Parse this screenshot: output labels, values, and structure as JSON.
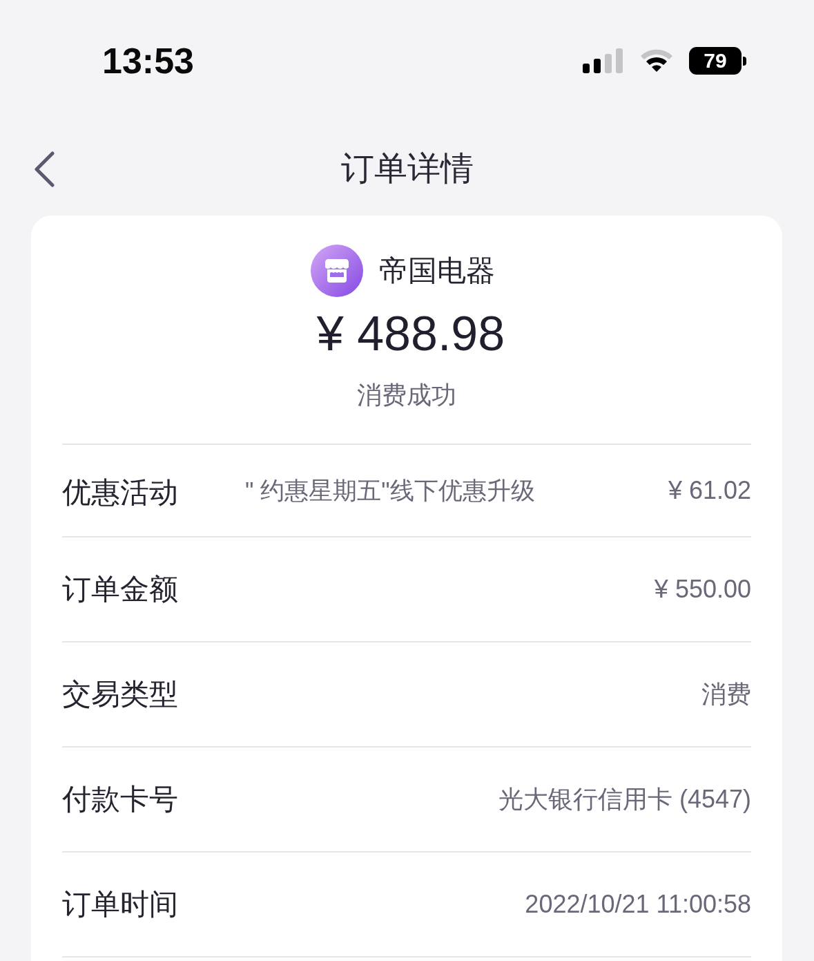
{
  "status_bar": {
    "time": "13:53",
    "battery": "79"
  },
  "nav": {
    "title": "订单详情"
  },
  "merchant": {
    "name": "帝国电器"
  },
  "summary": {
    "amount": "¥ 488.98",
    "status": "消费成功"
  },
  "rows": [
    {
      "kind": "promo",
      "label": "优惠活动",
      "detail": "\" 约惠星期五\"线下优惠升级",
      "value": "¥ 61.02"
    },
    {
      "kind": "plain",
      "label": "订单金额",
      "value": "¥ 550.00"
    },
    {
      "kind": "plain",
      "label": "交易类型",
      "value": "消费"
    },
    {
      "kind": "plain",
      "label": "付款卡号",
      "value": "光大银行信用卡 (4547)"
    },
    {
      "kind": "plain",
      "label": "订单时间",
      "value": "2022/10/21 11:00:58"
    }
  ]
}
